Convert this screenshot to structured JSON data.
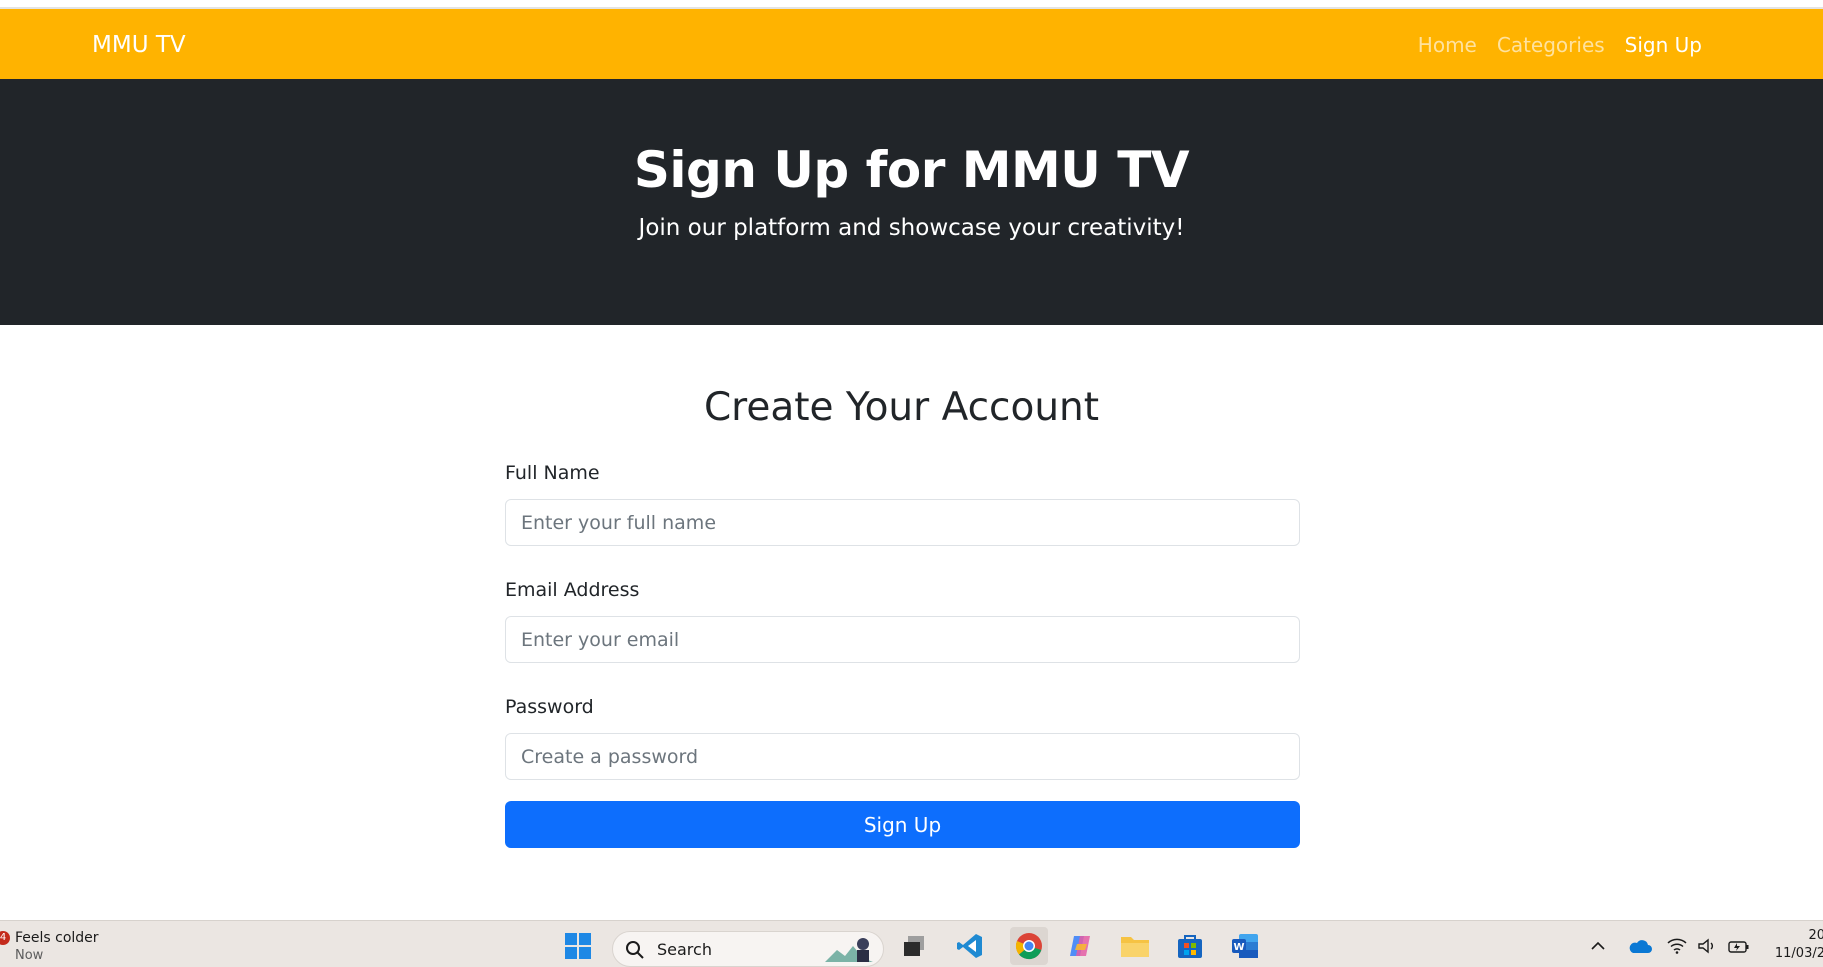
{
  "navbar": {
    "brand": "MMU TV",
    "links": [
      {
        "label": "Home",
        "active": false
      },
      {
        "label": "Categories",
        "active": false
      },
      {
        "label": "Sign Up",
        "active": true
      }
    ]
  },
  "hero": {
    "title": "Sign Up for MMU TV",
    "subtitle": "Join our platform and showcase your creativity!"
  },
  "form": {
    "title": "Create Your Account",
    "fields": [
      {
        "label": "Full Name",
        "placeholder": "Enter your full name"
      },
      {
        "label": "Email Address",
        "placeholder": "Enter your email"
      },
      {
        "label": "Password",
        "placeholder": "Create a password"
      }
    ],
    "submit_label": "Sign Up"
  },
  "taskbar": {
    "weather": {
      "badge": "4",
      "text": "Feels colder",
      "sub": "Now"
    },
    "search_label": "Search",
    "clock": {
      "time": "20",
      "date": "11/03/2"
    }
  },
  "colors": {
    "navbar_bg": "#ffb300",
    "hero_bg": "#212529",
    "button_bg": "#0d6efd",
    "taskbar_bg": "#ebe6e2"
  }
}
